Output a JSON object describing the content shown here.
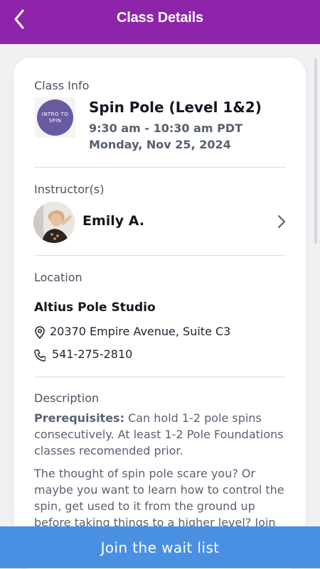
{
  "header": {
    "title": "Class Details",
    "back_icon": "chevron-left-icon",
    "color": "#8e24aa"
  },
  "class_info": {
    "section_label": "Class Info",
    "thumbnail_text": "INTRO TO SPIN",
    "name": "Spin Pole (Level 1&2)",
    "time": "9:30 am - 10:30 am PDT",
    "date": "Monday, Nov 25, 2024"
  },
  "instructor": {
    "section_label": "Instructor(s)",
    "name": "Emily A.",
    "chevron_icon": "chevron-right-icon"
  },
  "location": {
    "section_label": "Location",
    "studio": "Altius Pole Studio",
    "address": "20370 Empire Avenue, Suite C3",
    "phone": "541-275-2810",
    "address_icon": "map-pin-icon",
    "phone_icon": "phone-icon"
  },
  "description": {
    "section_label": "Description",
    "prereq_label": "Prerequisites:",
    "prereq_text": " Can hold 1-2 pole spins consecutively. At least 1-2 Pole Foundations classes recomended prior.",
    "body": "The thought of spin pole scare you? Or maybe you want to learn how to control the spin, get used to it from the ground up before taking things to a higher level? Join us for Intro to spin"
  },
  "action": {
    "label": "Join the wait list",
    "color": "#4a90e2"
  }
}
